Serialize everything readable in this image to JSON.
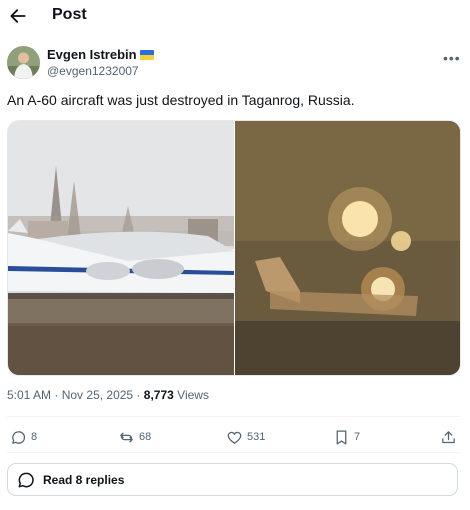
{
  "header": {
    "title": "Post"
  },
  "author": {
    "name": "Evgen Istrebin",
    "handle": "@evgen1232007"
  },
  "tweet": {
    "text": "An A-60 aircraft was just destroyed in Taganrog, Russia.",
    "time": "5:01 AM",
    "sep": "·",
    "date": "Nov 25, 2025",
    "views_count": "8,773",
    "views_label": "Views"
  },
  "actions": {
    "replies": "8",
    "reposts": "68",
    "likes": "531",
    "bookmarks": "7"
  },
  "read_replies": {
    "label": "Read 8 replies"
  },
  "icons": [
    "back-arrow-icon",
    "more-icon",
    "reply-icon",
    "repost-icon",
    "like-icon",
    "bookmark-icon",
    "share-icon",
    "chat-bubble-icon"
  ],
  "colors": {
    "text": "#0f1419",
    "secondary": "#536471",
    "border": "#cfd9de"
  }
}
